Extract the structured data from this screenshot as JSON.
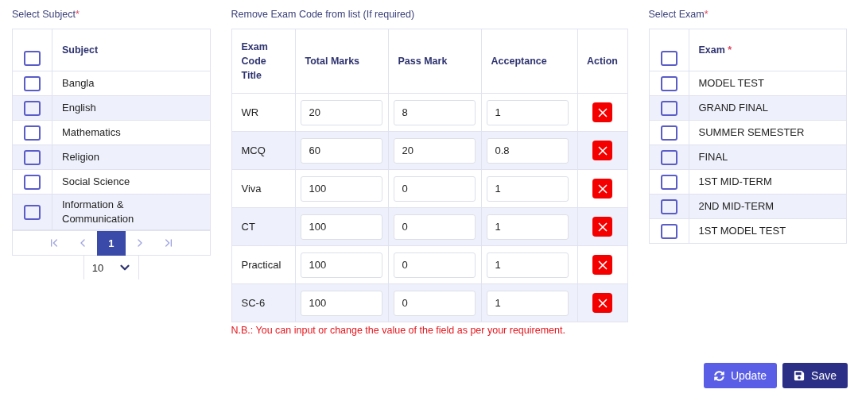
{
  "subject_panel": {
    "label": "Select Subject",
    "required_mark": "*",
    "header": "Subject",
    "header_checked": false,
    "rows": [
      {
        "name": "Bangla",
        "checked": false
      },
      {
        "name": "English",
        "checked": false
      },
      {
        "name": "Mathematics",
        "checked": false
      },
      {
        "name": "Religion",
        "checked": false
      },
      {
        "name": "Social Science",
        "checked": false
      },
      {
        "name": "Information & Communication",
        "checked": false
      }
    ],
    "pages": [
      {
        "label": "1",
        "selected": true
      }
    ],
    "page_size": "10"
  },
  "exam_code_panel": {
    "label": "Remove Exam Code from list (If required)",
    "columns": [
      "Exam Code Title",
      "Total Marks",
      "Pass Mark",
      "Acceptance",
      "Action"
    ],
    "rows": [
      {
        "code": "WR",
        "total": "20",
        "pass": "8",
        "acceptance": "1"
      },
      {
        "code": "MCQ",
        "total": "60",
        "pass": "20",
        "acceptance": "0.8"
      },
      {
        "code": "Viva",
        "total": "100",
        "pass": "0",
        "acceptance": "1"
      },
      {
        "code": "CT",
        "total": "100",
        "pass": "0",
        "acceptance": "1"
      },
      {
        "code": "Practical",
        "total": "100",
        "pass": "0",
        "acceptance": "1"
      },
      {
        "code": "SC-6",
        "total": "100",
        "pass": "0",
        "acceptance": "1"
      }
    ],
    "note": "N.B.: You can input or change the value of the field as per your requirement."
  },
  "exam_panel": {
    "label": "Select Exam",
    "required_mark": "*",
    "header": "Exam",
    "header_mark": "*",
    "header_checked": false,
    "rows": [
      {
        "name": "MODEL TEST",
        "checked": false
      },
      {
        "name": "GRAND FINAL",
        "checked": false
      },
      {
        "name": "SUMMER SEMESTER",
        "checked": false
      },
      {
        "name": "FINAL",
        "checked": false
      },
      {
        "name": "1ST MID-TERM",
        "checked": false
      },
      {
        "name": "2ND MID-TERM",
        "checked": false
      },
      {
        "name": "1ST MODEL TEST",
        "checked": false
      }
    ]
  },
  "buttons": [
    {
      "kind": "update",
      "label": "Update"
    },
    {
      "kind": "save",
      "label": "Save"
    }
  ]
}
